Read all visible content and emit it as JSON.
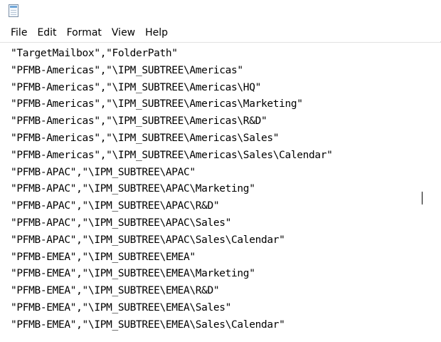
{
  "menu": {
    "items": [
      "File",
      "Edit",
      "Format",
      "View",
      "Help"
    ]
  },
  "document": {
    "lines": [
      "\"TargetMailbox\",\"FolderPath\"",
      "\"PFMB-Americas\",\"\\IPM_SUBTREE\\Americas\"",
      "\"PFMB-Americas\",\"\\IPM_SUBTREE\\Americas\\HQ\"",
      "\"PFMB-Americas\",\"\\IPM_SUBTREE\\Americas\\Marketing\"",
      "\"PFMB-Americas\",\"\\IPM_SUBTREE\\Americas\\R&D\"",
      "\"PFMB-Americas\",\"\\IPM_SUBTREE\\Americas\\Sales\"",
      "\"PFMB-Americas\",\"\\IPM_SUBTREE\\Americas\\Sales\\Calendar\"",
      "\"PFMB-APAC\",\"\\IPM_SUBTREE\\APAC\"",
      "\"PFMB-APAC\",\"\\IPM_SUBTREE\\APAC\\Marketing\"",
      "\"PFMB-APAC\",\"\\IPM_SUBTREE\\APAC\\R&D\"",
      "\"PFMB-APAC\",\"\\IPM_SUBTREE\\APAC\\Sales\"",
      "\"PFMB-APAC\",\"\\IPM_SUBTREE\\APAC\\Sales\\Calendar\"",
      "\"PFMB-EMEA\",\"\\IPM_SUBTREE\\EMEA\"",
      "\"PFMB-EMEA\",\"\\IPM_SUBTREE\\EMEA\\Marketing\"",
      "\"PFMB-EMEA\",\"\\IPM_SUBTREE\\EMEA\\R&D\"",
      "\"PFMB-EMEA\",\"\\IPM_SUBTREE\\EMEA\\Sales\"",
      "\"PFMB-EMEA\",\"\\IPM_SUBTREE\\EMEA\\Sales\\Calendar\""
    ]
  }
}
